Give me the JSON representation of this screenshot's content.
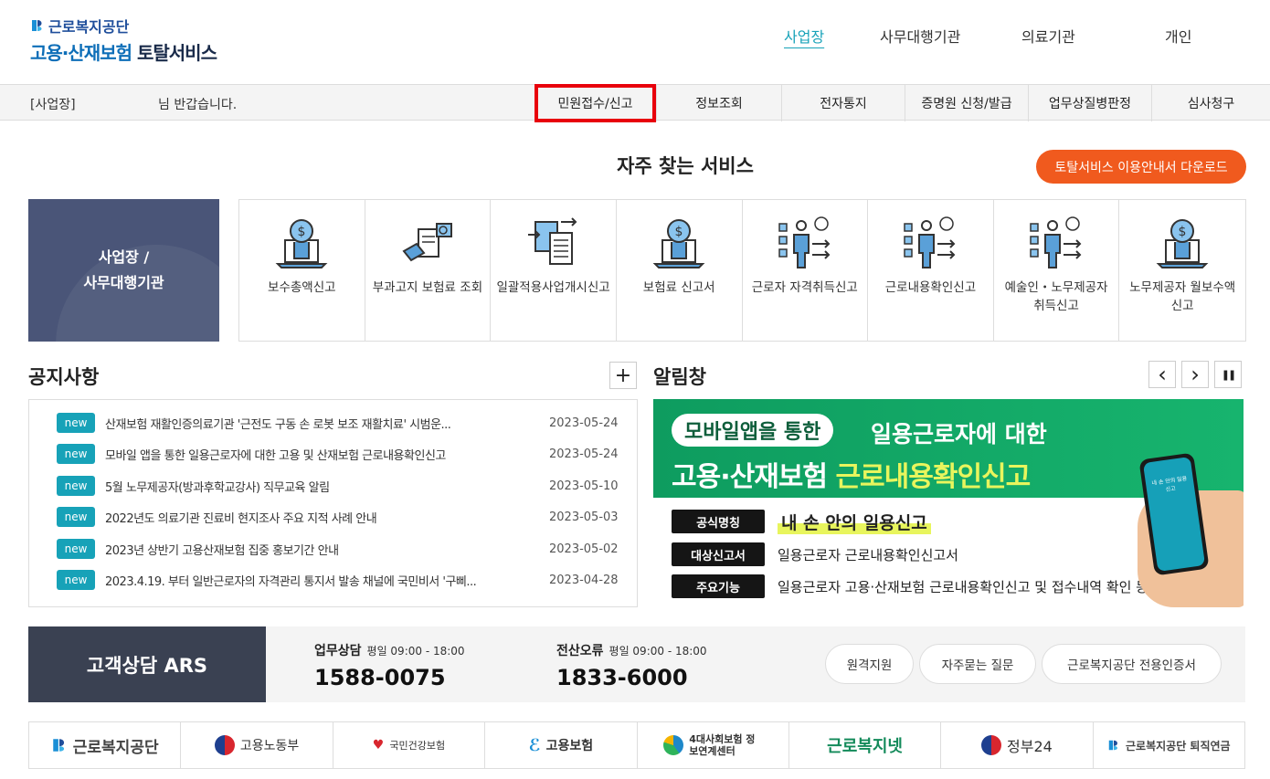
{
  "header": {
    "logo_top": "근로복지공단",
    "logo_main_blue": "고용·산재보험",
    "logo_main_dark": "토탈서비스",
    "nav": [
      {
        "label": "사업장",
        "active": true
      },
      {
        "label": "사무대행기관",
        "active": false
      },
      {
        "label": "의료기관",
        "active": false
      },
      {
        "label": "개인",
        "active": false
      }
    ]
  },
  "subbar": {
    "who": "[사업장]",
    "greeting": "님 반갑습니다.",
    "menu": [
      "민원접수/신고",
      "정보조회",
      "전자통지",
      "증명원 신청/발급",
      "업무상질병판정",
      "심사청구"
    ]
  },
  "frequent": {
    "title": "자주 찾는 서비스",
    "guide_button": "토탈서비스 이용안내서 다운로드",
    "category_line1": "사업장 /",
    "category_line2": "사무대행기관",
    "services": [
      {
        "label": "보수총액신고",
        "icon": "money-laptop-icon"
      },
      {
        "label": "부과고지 보험료 조회",
        "icon": "document-search-icon"
      },
      {
        "label": "일괄적용사업개시신고",
        "icon": "document-transfer-icon"
      },
      {
        "label": "보험료 신고서",
        "icon": "money-laptop-icon"
      },
      {
        "label": "근로자 자격취득신고",
        "icon": "worker-list-icon"
      },
      {
        "label": "근로내용확인신고",
        "icon": "worker-list-icon"
      },
      {
        "label": "예술인・노무제공자 취득신고",
        "icon": "worker-list-icon"
      },
      {
        "label": "노무제공자 월보수액 신고",
        "icon": "money-laptop-icon"
      }
    ]
  },
  "notices": {
    "title": "공지사항",
    "more": "+",
    "badge": "new",
    "items": [
      {
        "text": "산재보험 재활인증의료기관 '근전도 구동 손 로봇 보조 재활치료' 시범운...",
        "date": "2023-05-24"
      },
      {
        "text": "모바일 앱을 통한 일용근로자에 대한 고용 및 산재보험 근로내용확인신고",
        "date": "2023-05-24"
      },
      {
        "text": "5월 노무제공자(방과후학교강사) 직무교육 알림",
        "date": "2023-05-10"
      },
      {
        "text": "2022년도 의료기관 진료비 현지조사 주요 지적 사례 안내",
        "date": "2023-05-03"
      },
      {
        "text": "2023년 상반기 고용산재보험 집중 홍보기간 안내",
        "date": "2023-05-02"
      },
      {
        "text": "2023.4.19. 부터 일반근로자의 자격관리 통지서 발송 채널에 국민비서 '구삐...",
        "date": "2023-04-28"
      }
    ]
  },
  "alarm": {
    "title": "알림창",
    "prev": "‹",
    "next": "›",
    "pause": "❚❚",
    "banner": {
      "pill": "모바일앱을 통한",
      "line1": "일용근로자에 대한",
      "line2a": "고용·산재보험",
      "line2b": "근로내용확인신고",
      "rows": [
        {
          "tag": "공식명칭",
          "value": "내 손 안의 일용신고"
        },
        {
          "tag": "대상신고서",
          "value": "일용근로자 근로내용확인신고서"
        },
        {
          "tag": "주요기능",
          "value": "일용근로자 고용·산재보험 근로내용확인신고 및 접수내역 확인 등"
        }
      ],
      "phone_text": "내 손 안의 일용신고"
    }
  },
  "contact": {
    "title": "고객상담 ARS",
    "blocks": [
      {
        "head": "업무상담",
        "hours": "평일 09:00 - 18:00",
        "number": "1588-0075"
      },
      {
        "head": "전산오류",
        "hours": "평일 09:00 - 18:00",
        "number": "1833-6000"
      }
    ],
    "buttons": [
      "원격지원",
      "자주묻는 질문",
      "근로복지공단 전용인증서"
    ]
  },
  "partners": [
    {
      "label": "근로복지공단",
      "icon": "comwel-logo-icon"
    },
    {
      "label": "고용노동부",
      "icon": "taegeuk-logo-icon"
    },
    {
      "label": "국민건강보험",
      "icon": "nhis-logo-icon"
    },
    {
      "label": "고용보험",
      "icon": "ei-logo-icon"
    },
    {
      "label": "4대사회보험 정보연계센터",
      "icon": "4insure-logo-icon"
    },
    {
      "label": "근로복지넷",
      "icon": "welfare-net-logo-icon"
    },
    {
      "label": "정부24",
      "icon": "taegeuk-logo-icon"
    },
    {
      "label": "근로복지공단 퇴직연금",
      "icon": "comwel-logo-icon"
    }
  ],
  "colors": {
    "accent_teal": "#17a2b8",
    "accent_orange": "#f05a1e",
    "highlight_red": "#e8000b",
    "category_bg": "#4a5578",
    "banner_green": "#0e9c5f"
  }
}
